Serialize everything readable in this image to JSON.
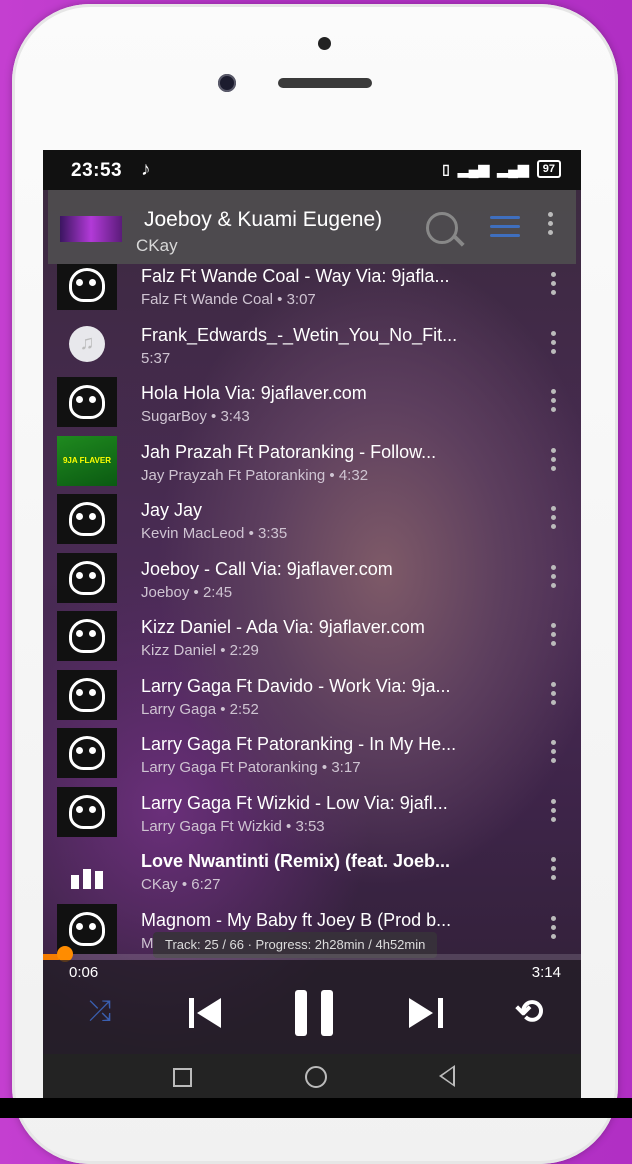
{
  "status_bar": {
    "time": "23:53",
    "battery": "97"
  },
  "now_playing": {
    "title": "Joeboy & Kuami Eugene)",
    "artist": "CKay",
    "search_icon": "search-icon",
    "queue_icon": "queue-icon",
    "more_icon": "more-vert-icon"
  },
  "tracks": [
    {
      "title": "Falz Ft Wande Coal - Way Via: 9jafla...",
      "sub": "Falz Ft Wande Coal  •  3:07",
      "art": "skull"
    },
    {
      "title": "Frank_Edwards_-_Wetin_You_No_Fit...",
      "sub": "5:37",
      "art": "note"
    },
    {
      "title": "Hola Hola Via: 9jaflaver.com",
      "sub": "SugarBoy  •  3:43",
      "art": "skull"
    },
    {
      "title": "Jah Prazah Ft Patoranking - Follow...",
      "sub": "Jay Prayzah Ft Patoranking  •  4:32",
      "art": "green"
    },
    {
      "title": "Jay Jay",
      "sub": "Kevin MacLeod  •  3:35",
      "art": "skull"
    },
    {
      "title": "Joeboy - Call Via: 9jaflaver.com",
      "sub": "Joeboy  •  2:45",
      "art": "skull"
    },
    {
      "title": "Kizz Daniel - Ada Via: 9jaflaver.com",
      "sub": "Kizz Daniel  •  2:29",
      "art": "skull"
    },
    {
      "title": "Larry Gaga Ft Davido - Work Via: 9ja...",
      "sub": "Larry Gaga  •  2:52",
      "art": "skull"
    },
    {
      "title": "Larry Gaga Ft Patoranking - In My He...",
      "sub": "Larry Gaga Ft Patoranking  •  3:17",
      "art": "skull"
    },
    {
      "title": "Larry Gaga Ft Wizkid - Low Via: 9jafl...",
      "sub": "Larry Gaga Ft Wizkid  •  3:53",
      "art": "skull"
    },
    {
      "title": "Love Nwantinti (Remix) (feat. Joeb...",
      "sub": "CKay  •  6:27",
      "art": "bars",
      "playing": true
    },
    {
      "title": "Magnom - My Baby ft Joey B (Prod b...",
      "sub": "M",
      "art": "skull"
    }
  ],
  "tooltip": "Track: 25 / 66 · Progress: 2h28min / 4h52min",
  "player": {
    "current_time": "0:06",
    "total_time": "3:14",
    "progress": 0.03,
    "accent": "#f57c00"
  },
  "controls": {
    "shuffle_icon": "shuffle-icon",
    "prev_icon": "skip-previous-icon",
    "pause_icon": "pause-icon",
    "next_icon": "skip-next-icon",
    "repeat_icon": "repeat-icon"
  }
}
